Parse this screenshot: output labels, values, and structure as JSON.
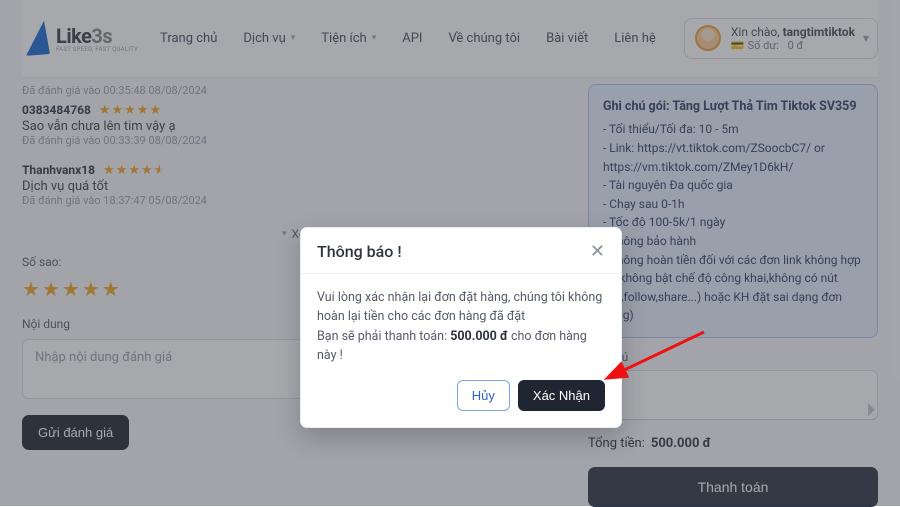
{
  "brand": {
    "name": "Like",
    "suffix": "3s",
    "tagline": "FAST SPEED, FAST QUALITY"
  },
  "nav": {
    "home": "Trang chủ",
    "services": "Dịch vụ",
    "utils": "Tiện ích",
    "api": "API",
    "about": "Về chúng tôi",
    "articles": "Bài viết",
    "contact": "Liên hệ"
  },
  "user": {
    "hello": "Xin chào,",
    "name": "tangtimtiktok",
    "balance_label": "Số dư:",
    "balance_value": "0 đ"
  },
  "left": {
    "top_meta": "Đã đánh giá vào 00:35:48 08/08/2024",
    "reviews": [
      {
        "user": "0383484768",
        "stars": 5,
        "half": false,
        "body": "Sao vẫn chưa lên tim vậy ạ",
        "meta": "Đã đánh giá vào 00:33:39 08/08/2024"
      },
      {
        "user": "Thanhvanx18",
        "stars": 4,
        "half": true,
        "body": "Dịch vụ quá tốt",
        "meta": "Đã đánh giá vào 18:37:47 05/08/2024"
      }
    ],
    "see_more": "Xem thêm đánh giá",
    "stars_label": "Số sao:",
    "content_label": "Nội dung",
    "content_placeholder": "Nhập nội dung đánh giá",
    "submit": "Gửi đánh giá"
  },
  "right": {
    "note_title": "Ghi chú gói: Tăng Lượt Thả Tim Tiktok SV359",
    "note_lines": [
      "- Tối thiểu/Tối đa: 10 - 5m",
      "- Link: https://vt.tiktok.com/ZSoocbC7/ or https://vm.tiktok.com/ZMey1D6kH/",
      "- Tài nguyên Đa quốc gia",
      "- Chạy sau 0-1h",
      "- Tốc độ 100-5k/1 ngày",
      "- Không bảo hành",
      "- Không hoàn tiền đối với các đơn link không hợp lệ (không bật chế độ công khai,không có nút like,follow,share...) hoặc KH đặt sai dạng đơn hàng)"
    ],
    "ghichu_label": "Ghi chú",
    "total_label": "Tổng tiền:",
    "total_value": "500.000 đ",
    "pay": "Thanh toán"
  },
  "modal": {
    "title": "Thông báo !",
    "line1": "Vui lòng xác nhận lại đơn đặt hàng, chúng tôi không hoàn lại tiền cho các đơn hàng đã đặt",
    "line2a": "Bạn sẽ phải thanh toán: ",
    "line2b": "500.000 đ",
    "line2c": " cho đơn hàng này !",
    "cancel": "Hủy",
    "confirm": "Xác Nhận"
  }
}
